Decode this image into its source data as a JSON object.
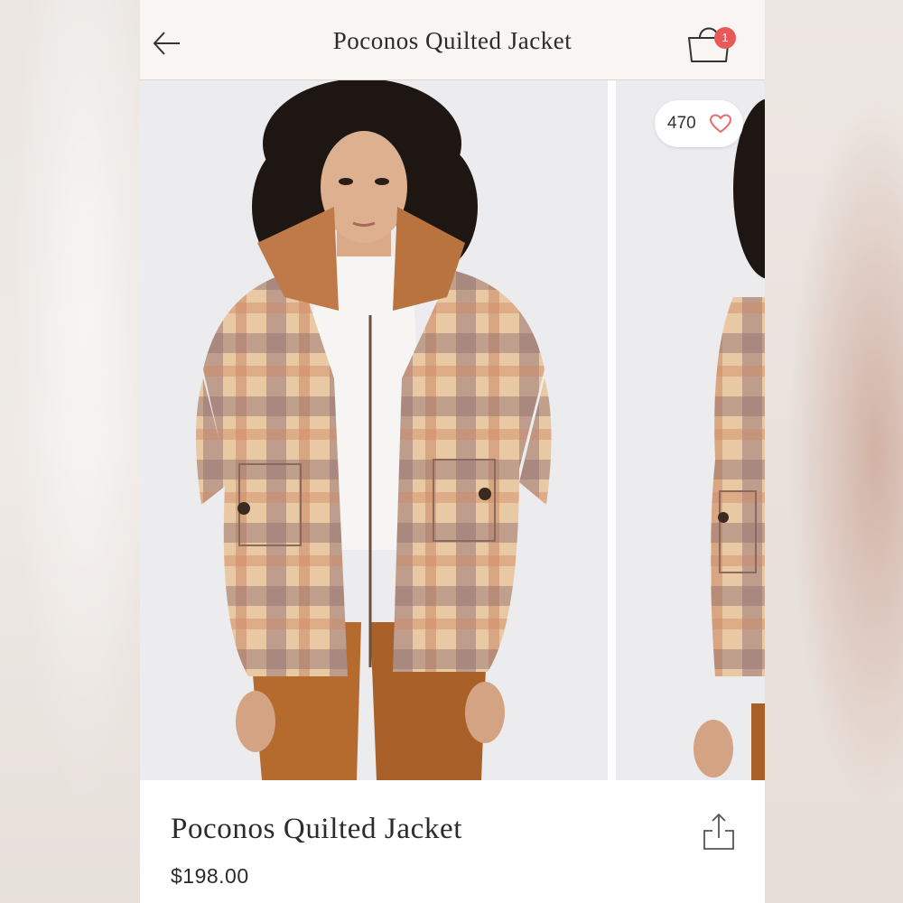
{
  "header": {
    "title": "Poconos Quilted Jacket",
    "back_icon": "back-arrow-icon",
    "bag_icon": "shopping-bag-icon",
    "bag_count": "1"
  },
  "gallery": {
    "like_count": "470",
    "like_icon": "heart-icon"
  },
  "product": {
    "name": "Poconos Quilted Jacket",
    "price": "$198.00",
    "share_icon": "share-icon"
  },
  "colors": {
    "badge": "#e85a5a",
    "heart": "#e86a6a",
    "text": "#2b2b2b"
  }
}
